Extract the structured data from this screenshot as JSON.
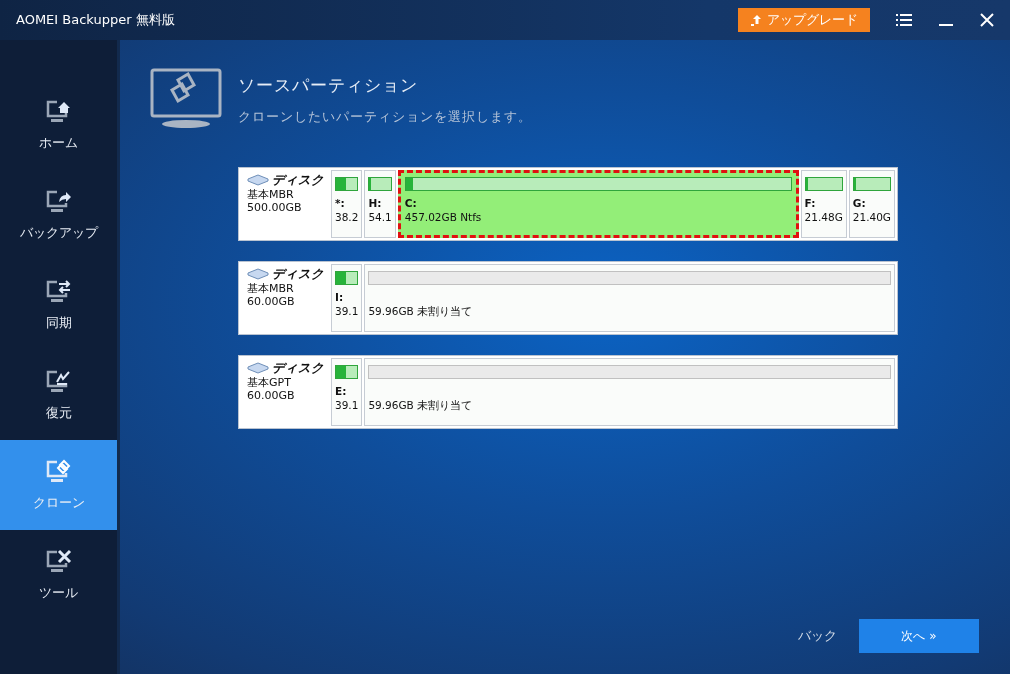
{
  "window": {
    "title": "AOMEI Backupper 無料版",
    "upgrade_button": "アップグレード"
  },
  "sidebar": {
    "items": [
      {
        "label": "ホーム",
        "selected": false
      },
      {
        "label": "バックアップ",
        "selected": false
      },
      {
        "label": "同期",
        "selected": false
      },
      {
        "label": "復元",
        "selected": false
      },
      {
        "label": "クローン",
        "selected": true
      },
      {
        "label": "ツール",
        "selected": false
      }
    ]
  },
  "header": {
    "title": "ソースパーティション",
    "subtitle": "クローンしたいパーティションを選択します。"
  },
  "disks": [
    {
      "name": "ディスク",
      "type": "基本MBR",
      "size": "500.00GB",
      "partitions": [
        {
          "kind": "partition",
          "label": "*:",
          "size": "38.2",
          "level": 0.45,
          "selected": false
        },
        {
          "kind": "partition",
          "label": "H:",
          "size": "54.1",
          "level": 0.08,
          "selected": false
        },
        {
          "kind": "partition",
          "label": "C:",
          "size": "457.02GB Ntfs",
          "level": 0.02,
          "selected": true
        },
        {
          "kind": "partition",
          "label": "F:",
          "size": "21.48G",
          "level": 0,
          "selected": false
        },
        {
          "kind": "partition",
          "label": "G:",
          "size": "21.40G",
          "level": 0,
          "selected": false
        }
      ]
    },
    {
      "name": "ディスク",
      "type": "基本MBR",
      "size": "60.00GB",
      "partitions": [
        {
          "kind": "partition",
          "label": "I:",
          "size": "39.1",
          "level": 0.45,
          "selected": false
        },
        {
          "kind": "unallocated",
          "size": "59.96GB 未割り当て",
          "selected": false
        }
      ]
    },
    {
      "name": "ディスク",
      "type": "基本GPT",
      "size": "60.00GB",
      "partitions": [
        {
          "kind": "partition",
          "label": "E:",
          "size": "39.1",
          "level": 0.45,
          "selected": false
        },
        {
          "kind": "unallocated",
          "size": "59.96GB 未割り当て",
          "selected": false
        }
      ]
    }
  ],
  "footer": {
    "back": "バック",
    "next": "次へ »"
  }
}
